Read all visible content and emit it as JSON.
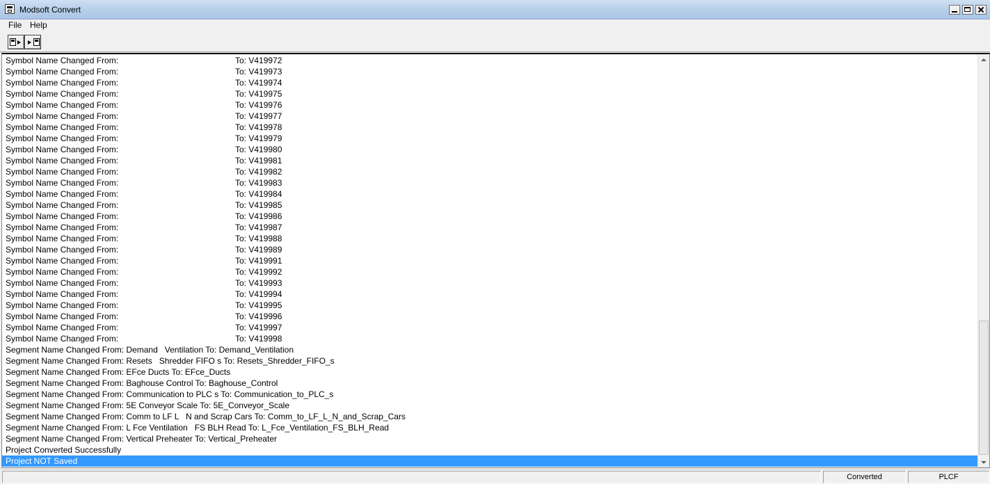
{
  "window": {
    "title": "Modsoft Convert",
    "icon": "app-icon"
  },
  "menu": {
    "items": [
      "File",
      "Help"
    ]
  },
  "toolbar": {
    "buttons": [
      "export-disk-icon",
      "import-disk-icon"
    ]
  },
  "log": {
    "symbol_prefix": "Symbol Name Changed From:",
    "symbol_to_values": [
      "To: V419972",
      "To: V419973",
      "To: V419974",
      "To: V419975",
      "To: V419976",
      "To: V419977",
      "To: V419978",
      "To: V419979",
      "To: V419980",
      "To: V419981",
      "To: V419982",
      "To: V419983",
      "To: V419984",
      "To: V419985",
      "To: V419986",
      "To: V419987",
      "To: V419988",
      "To: V419989",
      "To: V419991",
      "To: V419992",
      "To: V419993",
      "To: V419994",
      "To: V419995",
      "To: V419996",
      "To: V419997",
      "To: V419998"
    ],
    "segment_lines": [
      "Segment Name Changed From: Demand   Ventilation To: Demand_Ventilation",
      "Segment Name Changed From: Resets   Shredder FIFO s To: Resets_Shredder_FIFO_s",
      "Segment Name Changed From: EFce Ducts To: EFce_Ducts",
      "Segment Name Changed From: Baghouse Control To: Baghouse_Control",
      "Segment Name Changed From: Communication to PLC s To: Communication_to_PLC_s",
      "Segment Name Changed From: 5E Conveyor Scale To: 5E_Conveyor_Scale",
      "Segment Name Changed From: Comm to LF L   N and Scrap Cars To: Comm_to_LF_L_N_and_Scrap_Cars",
      "Segment Name Changed From: L Fce Ventilation   FS BLH Read To: L_Fce_Ventilation_FS_BLH_Read",
      "Segment Name Changed From: Vertical Preheater To: Vertical_Preheater"
    ],
    "converted_line": "Project Converted Successfully",
    "selected_line": "Project NOT Saved"
  },
  "statusbar": {
    "main": "",
    "state": "Converted",
    "mode": "PLCF"
  }
}
